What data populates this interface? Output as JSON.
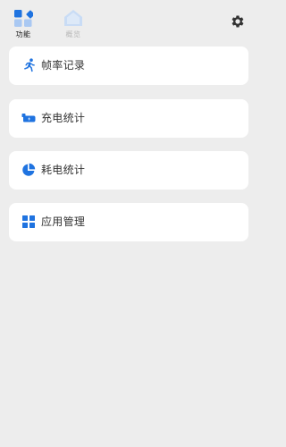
{
  "colors": {
    "background": "#ededed",
    "card": "#ffffff",
    "accent": "#1f73e0",
    "accent_light": "#a9c8f2",
    "tab_inactive": "#b8b8b8",
    "text": "#333333"
  },
  "tabs": [
    {
      "label": "功能",
      "icon": "grid-diamond-icon",
      "active": true
    },
    {
      "label": "概览",
      "icon": "house-icon",
      "active": false
    }
  ],
  "header": {
    "settings_icon": "gear-icon"
  },
  "menu": [
    {
      "label": "帧率记录",
      "icon": "running-man-icon"
    },
    {
      "label": "充电统计",
      "icon": "battery-charging-icon"
    },
    {
      "label": "耗电统计",
      "icon": "pie-chart-icon"
    },
    {
      "label": "应用管理",
      "icon": "app-grid-icon"
    }
  ]
}
